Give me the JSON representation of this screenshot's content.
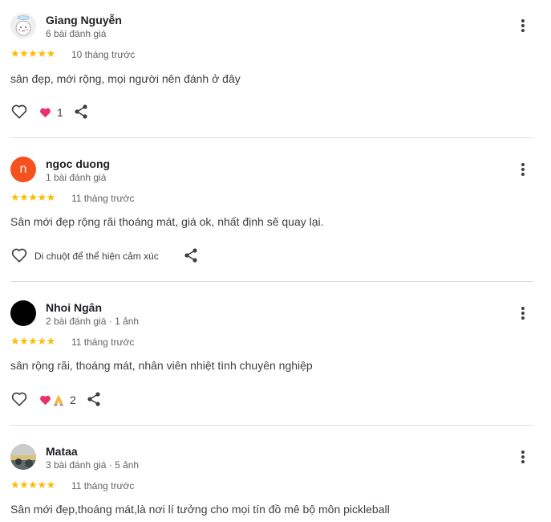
{
  "reviews": [
    {
      "name": "Giang Nguyễn",
      "meta": "6 bài đánh giá",
      "rating": 5,
      "stars": "★★★★★",
      "time": "10 tháng trước",
      "text": "sân đẹp, mới rộng, mọi người nên đánh ở đây",
      "reaction_count": "1",
      "reactions": [
        "heart-emoji"
      ]
    },
    {
      "name": "ngoc duong",
      "avatar_letter": "n",
      "meta": "1 bài đánh giá",
      "rating": 5,
      "stars": "★★★★★",
      "time": "11 tháng trước",
      "text": "Sân mới đẹp rộng rãi thoáng mát, giá ok, nhất định sẽ quay lại.",
      "hover_hint": "Di chuột để thể hiện cảm xúc"
    },
    {
      "name": "Nhoi Ngân",
      "meta": "2 bài đánh giá · 1 ảnh",
      "rating": 5,
      "stars": "★★★★★",
      "time": "11 tháng trước",
      "text": "sân rộng rãi, thoáng mát, nhân viên nhiệt tình chuyên nghiệp",
      "reaction_count": "2",
      "reactions": [
        "heart-emoji",
        "pray-emoji"
      ]
    },
    {
      "name": "Mataa",
      "meta": "3 bài đánh giá · 5 ảnh",
      "rating": 5,
      "stars": "★★★★★",
      "time": "11 tháng trước",
      "text": "Sân mới đẹp,thoáng mát,là nơi lí tưởng cho mọi tín đồ mê bộ môn pickleball"
    }
  ],
  "colors": {
    "star": "#fbbc04",
    "avatar_orange": "#f4511e",
    "divider": "#dadce0",
    "heart_pink": "#e8336a"
  },
  "icons": [
    "more-vert-icon",
    "heart-outline-icon",
    "share-icon"
  ]
}
